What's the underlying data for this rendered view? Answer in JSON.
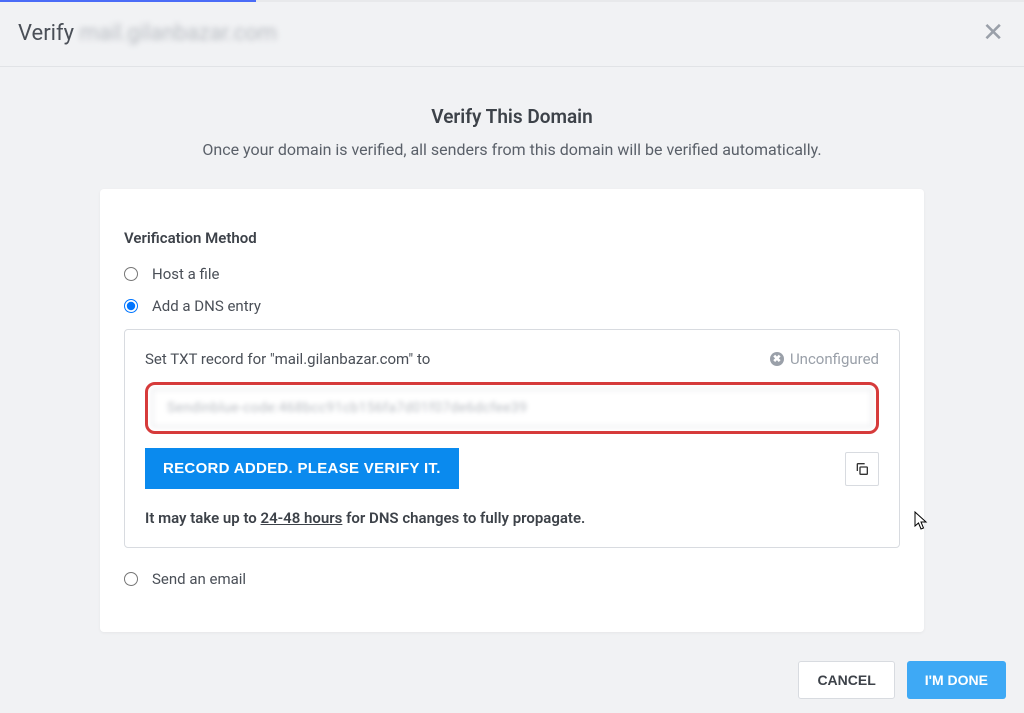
{
  "header": {
    "title_prefix": "Verify",
    "title_domain": "mail.gilanbazar.com"
  },
  "heading": {
    "title": "Verify This Domain",
    "subtitle": "Once your domain is verified, all senders from this domain will be verified automatically."
  },
  "verification": {
    "section_label": "Verification Method",
    "options": {
      "host_file": "Host a file",
      "dns_entry": "Add a DNS entry",
      "send_email": "Send an email"
    }
  },
  "dns": {
    "instruction": "Set TXT record for \"mail.gilanbazar.com\" to",
    "status_label": "Unconfigured",
    "txt_value": "Sendinblue-code:468bcc91cb156fa7d01f07de6dcfee39",
    "verify_button": "RECORD ADDED. PLEASE VERIFY IT.",
    "propagation_prefix": "It may take up to ",
    "propagation_hours": "24-48 hours",
    "propagation_suffix": " for DNS changes to fully propagate."
  },
  "footer": {
    "cancel": "CANCEL",
    "done": "I'M DONE"
  }
}
